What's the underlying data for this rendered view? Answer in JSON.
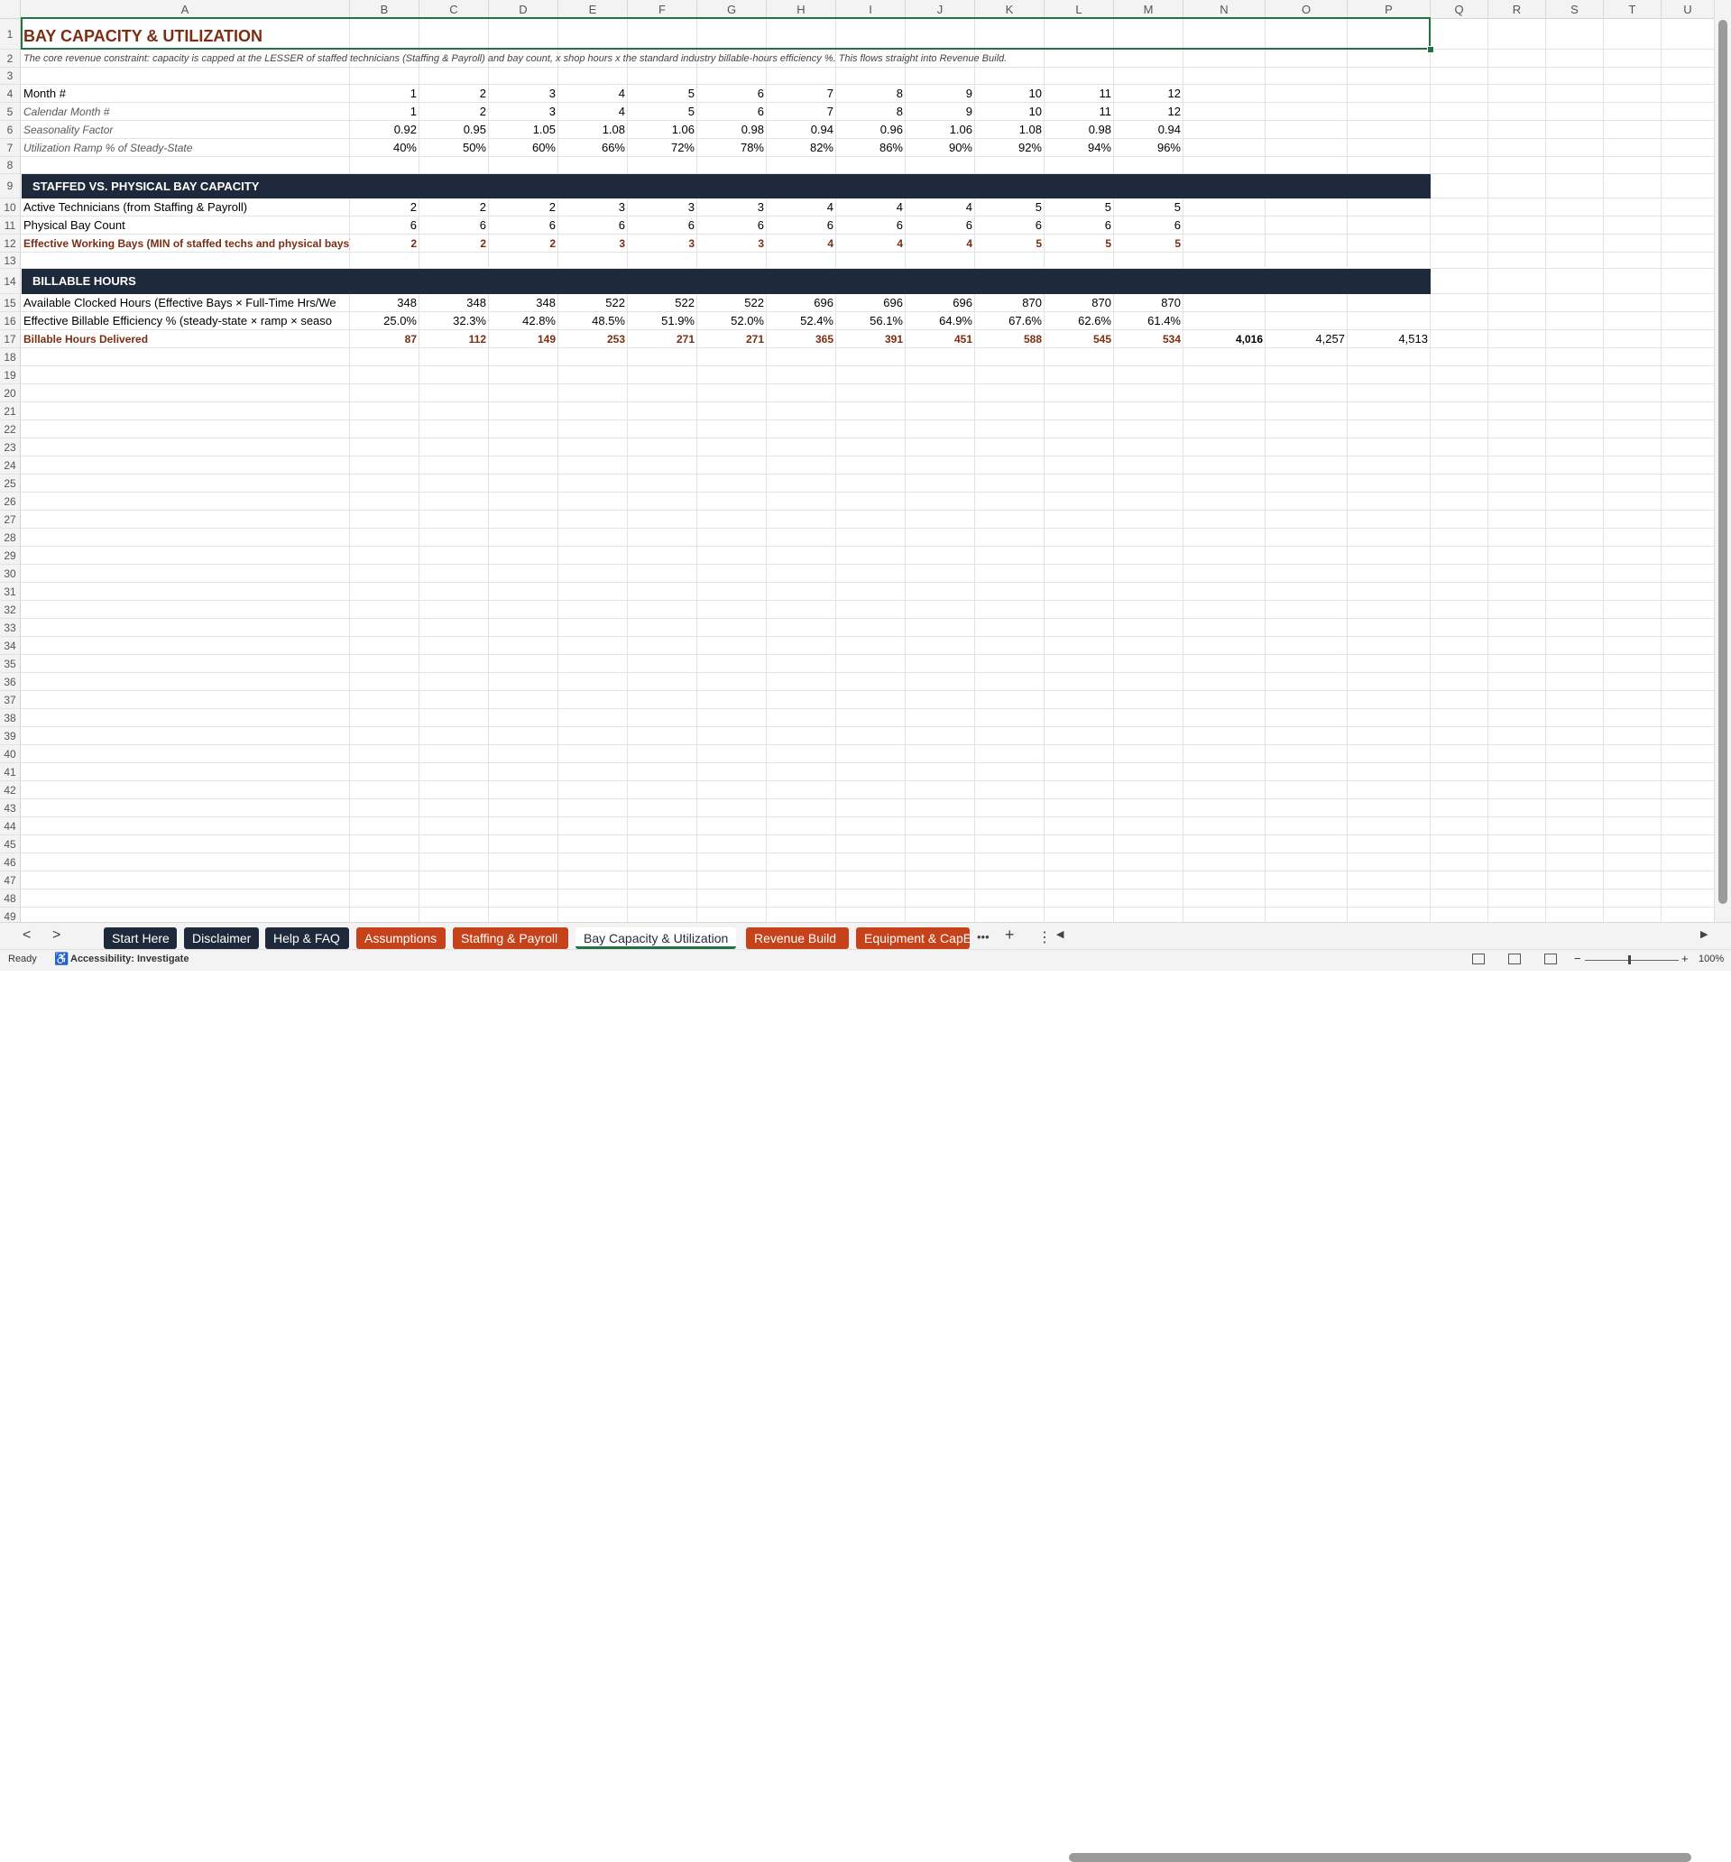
{
  "columns": [
    "A",
    "B",
    "C",
    "D",
    "E",
    "F",
    "G",
    "H",
    "I",
    "J",
    "K",
    "L",
    "M",
    "N",
    "O",
    "P",
    "Q",
    "R",
    "S",
    "T",
    "U"
  ],
  "row_numbers": [
    "1",
    "2",
    "3",
    "4",
    "5",
    "6",
    "7",
    "8",
    "9",
    "10",
    "11",
    "12",
    "13",
    "14",
    "15",
    "16",
    "17",
    "18",
    "19",
    "20",
    "21",
    "22",
    "23",
    "24",
    "25",
    "26",
    "27",
    "28",
    "29",
    "30",
    "31",
    "32",
    "33",
    "34",
    "35",
    "36",
    "37",
    "38",
    "39",
    "40",
    "41",
    "42",
    "43",
    "44",
    "45",
    "46",
    "47",
    "48",
    "49"
  ],
  "sheet": {
    "title": "BAY CAPACITY & UTILIZATION",
    "subtitle": "The core revenue constraint: capacity is capped at the LESSER of staffed technicians (Staffing & Payroll) and bay count, x shop hours x the standard industry billable-hours efficiency %. This flows straight into Revenue Build.",
    "rows": [
      {
        "label": "Month #",
        "values": [
          "1",
          "2",
          "3",
          "4",
          "5",
          "6",
          "7",
          "8",
          "9",
          "10",
          "11",
          "12"
        ]
      },
      {
        "label": "Calendar Month #",
        "values": [
          "1",
          "2",
          "3",
          "4",
          "5",
          "6",
          "7",
          "8",
          "9",
          "10",
          "11",
          "12"
        ]
      },
      {
        "label": "Seasonality Factor",
        "values": [
          "0.92",
          "0.95",
          "1.05",
          "1.08",
          "1.06",
          "0.98",
          "0.94",
          "0.96",
          "1.06",
          "1.08",
          "0.98",
          "0.94"
        ]
      },
      {
        "label": "Utilization Ramp % of Steady-State",
        "values": [
          "40%",
          "50%",
          "60%",
          "66%",
          "72%",
          "78%",
          "82%",
          "86%",
          "90%",
          "92%",
          "94%",
          "96%"
        ]
      },
      {
        "label": "Active Technicians (from Staffing & Payroll)",
        "values": [
          "2",
          "2",
          "2",
          "3",
          "3",
          "3",
          "4",
          "4",
          "4",
          "5",
          "5",
          "5"
        ]
      },
      {
        "label": "Physical Bay Count",
        "values": [
          "6",
          "6",
          "6",
          "6",
          "6",
          "6",
          "6",
          "6",
          "6",
          "6",
          "6",
          "6"
        ]
      },
      {
        "label": "Effective Working Bays (MIN of staffed techs and physical bays)",
        "values": [
          "2",
          "2",
          "2",
          "3",
          "3",
          "3",
          "4",
          "4",
          "4",
          "5",
          "5",
          "5"
        ]
      },
      {
        "label": "Available Clocked Hours (Effective Bays × Full-Time Hrs/We",
        "values": [
          "348",
          "348",
          "348",
          "522",
          "522",
          "522",
          "696",
          "696",
          "696",
          "870",
          "870",
          "870"
        ]
      },
      {
        "label": "Effective Billable Efficiency % (steady-state × ramp × seaso",
        "values": [
          "25.0%",
          "32.3%",
          "42.8%",
          "48.5%",
          "51.9%",
          "52.0%",
          "52.4%",
          "56.1%",
          "64.9%",
          "67.6%",
          "62.6%",
          "61.4%"
        ]
      },
      {
        "label": "Billable Hours Delivered",
        "values": [
          "87",
          "112",
          "149",
          "253",
          "271",
          "271",
          "365",
          "391",
          "451",
          "588",
          "545",
          "534"
        ],
        "totals": [
          "4,016",
          "4,257",
          "4,513"
        ]
      }
    ],
    "section_staffed": "STAFFED VS. PHYSICAL BAY CAPACITY",
    "section_billable": "BILLABLE HOURS"
  },
  "tabs": [
    {
      "label": "Start Here",
      "style": "dark"
    },
    {
      "label": "Disclaimer",
      "style": "dark"
    },
    {
      "label": "Help & FAQ",
      "style": "dark"
    },
    {
      "label": "Assumptions",
      "style": "orange"
    },
    {
      "label": "Staffing & Payroll",
      "style": "orange"
    },
    {
      "label": "Bay Capacity & Utilization",
      "style": "active"
    },
    {
      "label": "Revenue Build",
      "style": "orange"
    },
    {
      "label": "Equipment & CapEx",
      "style": "orange"
    }
  ],
  "tab_controls": {
    "more": "•••",
    "add": "+",
    "options": "⋮",
    "prev": "<",
    "next": ">"
  },
  "status": {
    "ready": "Ready",
    "accessibility": "Accessibility: Investigate",
    "zoom": "100%"
  },
  "colors": {
    "title": "#7b2e13",
    "section_bar": "#1e2a3b",
    "tab_orange": "#c5421a",
    "tab_dark": "#1e2a3b",
    "selection": "#217346"
  }
}
